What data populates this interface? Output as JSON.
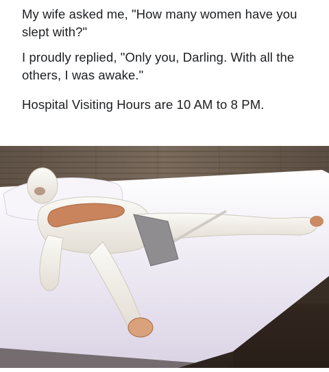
{
  "caption": {
    "line1": "My wife asked me, \"How many women have you slept with?\"",
    "line2": "I proudly replied, \"Only you, Darling.  With all the others, I was awake.\"",
    "line3": "Hospital Visiting Hours are 10 AM to 8 PM."
  },
  "photo": {
    "subject": "man-in-full-body-cast-on-bed",
    "colors": {
      "wall": "#6b5c4d",
      "mattress": "#ece8f2",
      "cast": "#f2efe9",
      "skin": "#c9845e",
      "rail": "#3b2f25"
    }
  }
}
